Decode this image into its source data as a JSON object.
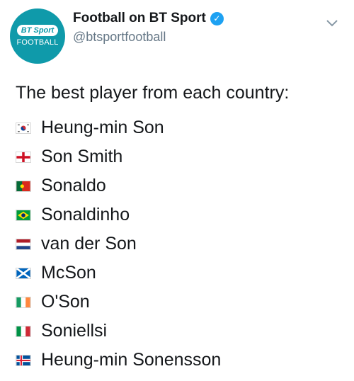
{
  "account": {
    "name": "Football on BT Sport",
    "handle": "@btsportfootball",
    "avatar_top": "BT Sport",
    "avatar_bottom": "FOOTBALL",
    "verified_icon": "verified-badge-icon"
  },
  "tweet": {
    "text": "The best player from each country:",
    "items": [
      {
        "flag": "south-korea-flag-icon",
        "label": "Heung-min Son"
      },
      {
        "flag": "england-flag-icon",
        "label": "Son Smith"
      },
      {
        "flag": "portugal-flag-icon",
        "label": "Sonaldo"
      },
      {
        "flag": "brazil-flag-icon",
        "label": "Sonaldinho"
      },
      {
        "flag": "netherlands-flag-icon",
        "label": "van der Son"
      },
      {
        "flag": "scotland-flag-icon",
        "label": "McSon"
      },
      {
        "flag": "ireland-flag-icon",
        "label": "O'Son"
      },
      {
        "flag": "italy-flag-icon",
        "label": "Soniellsi"
      },
      {
        "flag": "iceland-flag-icon",
        "label": "Heung-min Sonensson"
      }
    ]
  },
  "colors": {
    "brand": "#0f9aaa",
    "verified": "#1da1f2",
    "text": "#14171a",
    "secondary": "#657786"
  }
}
